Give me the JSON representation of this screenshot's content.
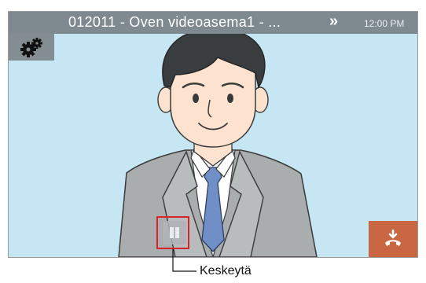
{
  "header": {
    "title": "012011 - Oven videoasema1 - ...",
    "next_glyph": "»",
    "time": "12:00 PM"
  },
  "icons": {
    "settings": "gears-icon",
    "pause": "pause-icon",
    "hangup": "hang-up-icon"
  },
  "colors": {
    "header_bg": "#7f8a90",
    "video_bg": "#c5e6f2",
    "hangup_bg": "#c96742",
    "highlight": "#d8232a"
  },
  "callout": {
    "label": "Keskeytä"
  }
}
